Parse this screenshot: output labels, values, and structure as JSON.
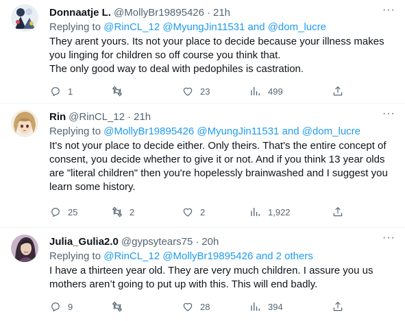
{
  "tweets": [
    {
      "name": "Donnaatje L.",
      "handle": "@MollyBr19895426",
      "time": "21h",
      "replying_prefix": "Replying to",
      "replying_links": "@RinCL_12 @MyungJin11531 and @dom_lucre",
      "lines": [
        "They arent yours. Its not your place to decide because your illness makes you linging for children so off course you think that.",
        "The only good way to deal with pedophiles is castration."
      ],
      "replies": "1",
      "retweets": "",
      "likes": "23",
      "views": "499"
    },
    {
      "name": "Rin",
      "handle": "@RinCL_12",
      "time": "21h",
      "replying_prefix": "Replying to",
      "replying_links": "@MollyBr19895426 @MyungJin11531 and @dom_lucre",
      "lines": [
        "It's not your place to decide either. Only theirs. That's the entire concept of consent, you decide whether to give it or not. And if you think 13 year olds are \"literal children\" then you're hopelessly brainwashed and I suggest you learn some history."
      ],
      "replies": "25",
      "retweets": "2",
      "likes": "2",
      "views": "1,922"
    },
    {
      "name": "Julia_Gulia2.0",
      "handle": "@gypsytears75",
      "time": "20h",
      "replying_prefix": "Replying to",
      "replying_links": "@RinCL_12 @MollyBr19895426 and 2 others",
      "lines": [
        "I have a thirteen year old. They are very much children. I assure you us mothers aren’t going to put up with this. This will end badly."
      ],
      "replies": "9",
      "retweets": "",
      "likes": "28",
      "views": "394"
    }
  ],
  "colors": {
    "link": "#1d9bf0",
    "secondary_text": "#536471",
    "primary_text": "#0f1419",
    "divider": "#eff3f4"
  },
  "icons": [
    "more-icon",
    "reply-icon",
    "retweet-icon",
    "like-icon",
    "views-icon",
    "share-icon"
  ]
}
